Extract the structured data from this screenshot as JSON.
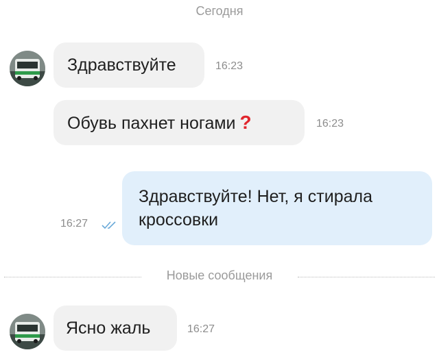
{
  "chat": {
    "date_separator": "Сегодня",
    "new_messages_separator": "Новые сообщения",
    "messages": [
      {
        "direction": "incoming",
        "text": "Здравствуйте",
        "time": "16:23"
      },
      {
        "direction": "incoming",
        "text": "Обувь пахнет ногами",
        "icon": "red-question-mark-icon",
        "time": "16:23"
      },
      {
        "direction": "outgoing",
        "text_line1": "Здравствуйте! Нет, я стирала",
        "text_line2": "кроссовки",
        "time": "16:27",
        "status": "read"
      },
      {
        "direction": "incoming",
        "text": "Ясно жаль",
        "time": "16:27"
      }
    ]
  },
  "colors": {
    "incoming_bubble": "#f1f1f1",
    "outgoing_bubble": "#e1effb",
    "read_check": "#6aa9d8",
    "question_mark": "#e1262d"
  }
}
